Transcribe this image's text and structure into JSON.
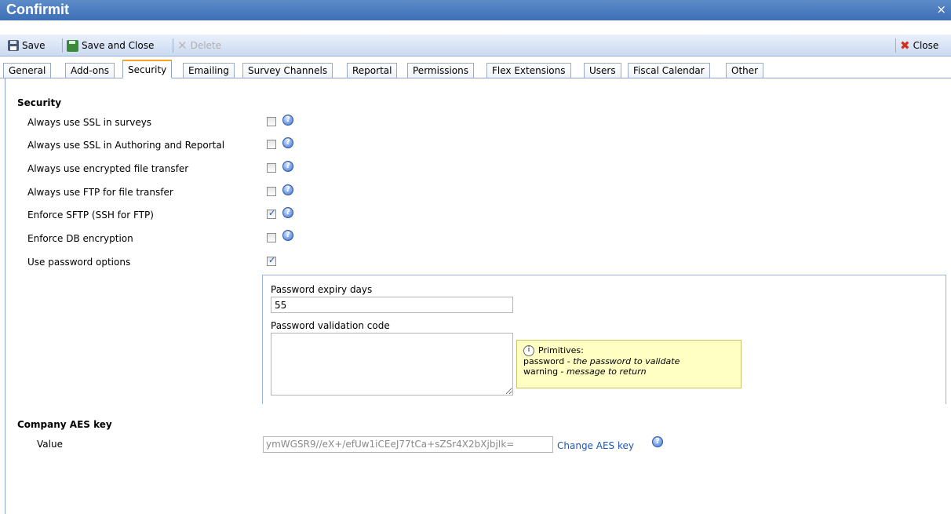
{
  "window": {
    "title": "Confirmit",
    "close_glyph": "×"
  },
  "toolbar": {
    "save_label": "Save",
    "save_close_label": "Save and Close",
    "delete_label": "Delete",
    "close_label": "Close"
  },
  "tabs": [
    {
      "label": "General"
    },
    {
      "label": "Add-ons"
    },
    {
      "label": "Security",
      "active": true
    },
    {
      "label": "Emailing"
    },
    {
      "label": "Survey Channels"
    },
    {
      "label": "Reportal"
    },
    {
      "label": "Permissions"
    },
    {
      "label": "Flex Extensions"
    },
    {
      "label": "Users"
    },
    {
      "label": "Fiscal Calendar"
    },
    {
      "label": "Other"
    }
  ],
  "security": {
    "heading": "Security",
    "options": [
      {
        "label": "Always use SSL in surveys",
        "checked": false,
        "help": true
      },
      {
        "label": "Always use SSL in Authoring and Reportal",
        "checked": false,
        "help": true
      },
      {
        "label": "Always use encrypted file transfer",
        "checked": false,
        "help": true
      },
      {
        "label": "Always use FTP for file transfer",
        "checked": false,
        "help": true
      },
      {
        "label": "Enforce SFTP (SSH for FTP)",
        "checked": true,
        "help": true
      },
      {
        "label": "Enforce DB encryption",
        "checked": false,
        "help": true
      },
      {
        "label": "Use password options",
        "checked": true,
        "help": false
      }
    ]
  },
  "password": {
    "expiry_label": "Password expiry days",
    "expiry_value": "55",
    "validation_label": "Password validation code",
    "validation_value": "",
    "tip": {
      "title": "Primitives:",
      "line1_key": "password",
      "line1_sep": " - ",
      "line1_desc": "the password to validate",
      "line2_key": "warning",
      "line2_sep": " - ",
      "line2_desc": "message to return"
    }
  },
  "aes": {
    "heading": "Company AES key",
    "value_label": "Value",
    "value": "ymWGSR9//eX+/efUw1iCEeJ77tCa+sZSr4X2bXjbjIk=",
    "change_link": "Change AES key"
  },
  "help_glyph": "?",
  "colors": {
    "titlebar": "#3d6fb6",
    "accent_tab": "#f5a623",
    "link": "#1f57b4",
    "tip_bg": "#ffffc4"
  }
}
